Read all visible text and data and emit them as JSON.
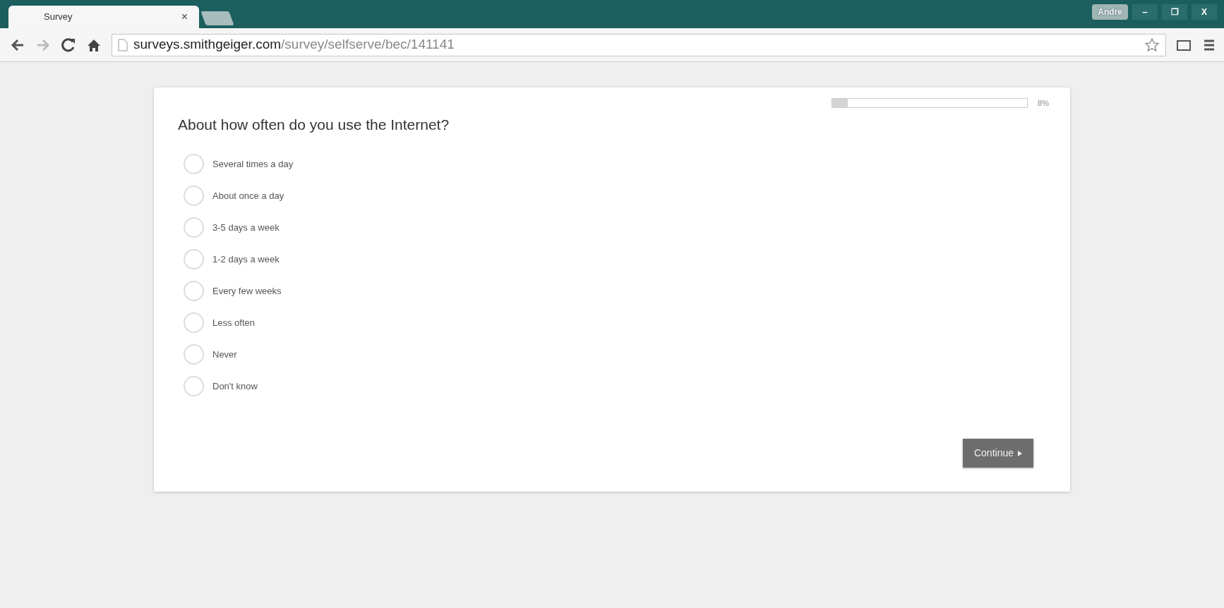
{
  "browser": {
    "tab": {
      "title": "Survey",
      "close": "×",
      "selected": true
    },
    "profile": "Andre",
    "window_controls": [
      "‒",
      "❐",
      "X"
    ],
    "address": {
      "host": "surveys.smithgeiger.com",
      "path": "/survey/selfserve/bec/141141"
    }
  },
  "survey": {
    "progress": {
      "level": 0.08,
      "reading": "8%"
    },
    "question": "About how often do you use the Internet?",
    "options": [
      {
        "label": "Several times a day",
        "selected": false
      },
      {
        "label": "About once a day",
        "selected": false
      },
      {
        "label": "3-5 days a week",
        "selected": false
      },
      {
        "label": "1-2 days a week",
        "selected": false
      },
      {
        "label": "Every few weeks",
        "selected": false
      },
      {
        "label": "Less often",
        "selected": false
      },
      {
        "label": "Never",
        "selected": false
      },
      {
        "label": "Don't know",
        "selected": false
      }
    ],
    "continue_button": "Continue"
  }
}
